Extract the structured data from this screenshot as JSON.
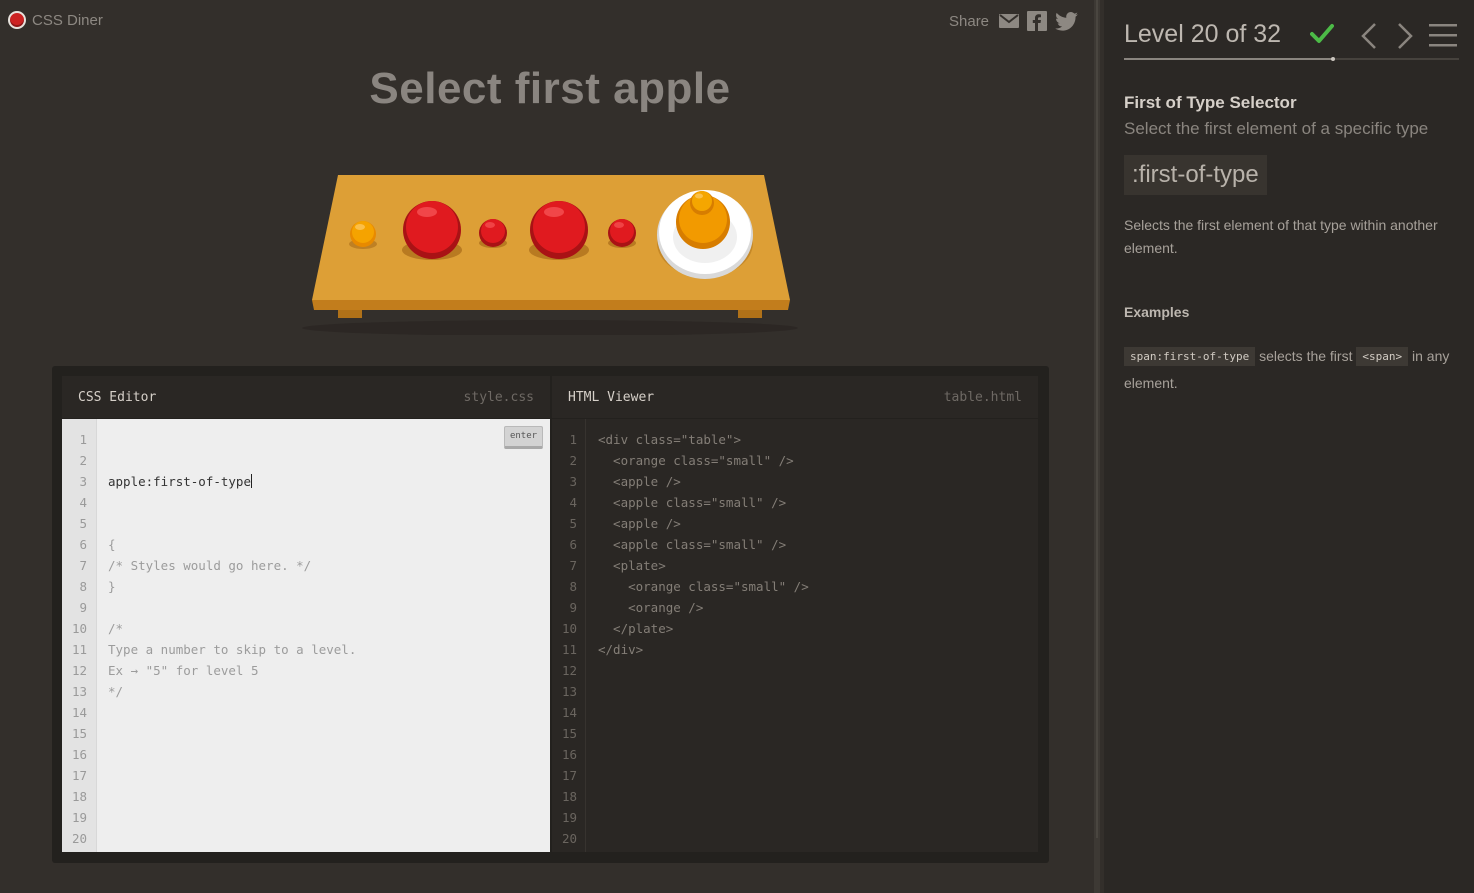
{
  "header": {
    "logo_text": "CSS Diner",
    "share_label": "Share",
    "share_icons": [
      "mail-icon",
      "facebook-icon",
      "twitter-icon"
    ]
  },
  "main": {
    "instruction": "Select first apple"
  },
  "table_items": [
    {
      "type": "orange",
      "size": "small"
    },
    {
      "type": "apple",
      "size": "large"
    },
    {
      "type": "apple",
      "size": "small"
    },
    {
      "type": "apple",
      "size": "large"
    },
    {
      "type": "apple",
      "size": "small"
    },
    {
      "type": "plate",
      "contents": [
        "orange (small)",
        "orange"
      ]
    }
  ],
  "css_editor": {
    "title": "CSS Editor",
    "filename": "style.css",
    "enter_label": "enter",
    "input_value": "apple:first-of-type",
    "lines": [
      "{",
      "/* Styles would go here. */",
      "}",
      "",
      "/*",
      "Type a number to skip to a level.",
      "Ex → \"5\" for level 5",
      "*/"
    ],
    "line_numbers": [
      "1",
      "2",
      "3",
      "4",
      "5",
      "6",
      "7",
      "8",
      "9",
      "10",
      "11",
      "12",
      "13",
      "14",
      "15",
      "16",
      "17",
      "18",
      "19",
      "20"
    ]
  },
  "html_viewer": {
    "title": "HTML Viewer",
    "filename": "table.html",
    "lines": [
      "<div class=\"table\">",
      "  <orange class=\"small\" />",
      "  <apple />",
      "  <apple class=\"small\" />",
      "  <apple />",
      "  <apple class=\"small\" />",
      "  <plate>",
      "    <orange class=\"small\" />",
      "    <orange />",
      "  </plate>",
      "</div>"
    ],
    "line_numbers": [
      "1",
      "2",
      "3",
      "4",
      "5",
      "6",
      "7",
      "8",
      "9",
      "10",
      "11",
      "12",
      "13",
      "14",
      "15",
      "16",
      "17",
      "18",
      "19",
      "20"
    ]
  },
  "sidebar": {
    "level_text": "Level 20 of 32",
    "level_completed": true,
    "progress_fraction": 0.625,
    "selector_name": "First of Type Selector",
    "selector_description": "Select the first element of a specific type",
    "syntax": ":first-of-type",
    "hint": "Selects the first element of that type within another element.",
    "examples_title": "Examples",
    "example_code": "span:first-of-type",
    "example_mid": " selects the first ",
    "example_tag": "<span>",
    "example_end": " in any element."
  },
  "colors": {
    "background": "#332f2b",
    "sidebar": "#2b2825",
    "check": "#4cbb47",
    "apple": "#d9161c",
    "orange": "#f29a00",
    "table": "#dd9f36"
  }
}
